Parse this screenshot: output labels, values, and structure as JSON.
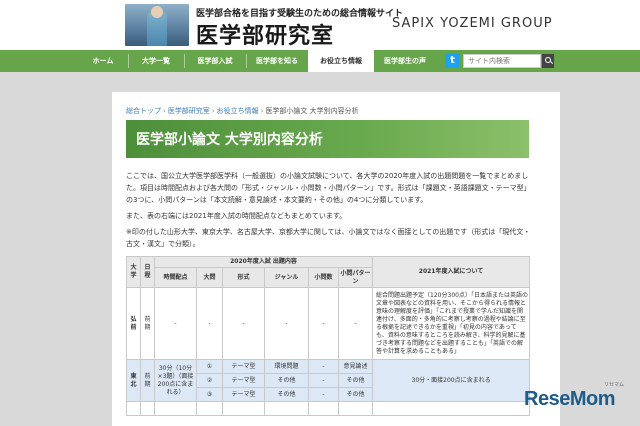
{
  "header": {
    "tagline": "医学部合格を目指す受験生のための総合情報サイト",
    "title": "医学部研究室",
    "group": "SAPIX YOZEMI GROUP"
  },
  "nav": {
    "items": [
      {
        "label": "ホーム"
      },
      {
        "label": "大学一覧"
      },
      {
        "label": "医学部入試"
      },
      {
        "label": "医学部を知る"
      },
      {
        "label": "お役立ち情報"
      },
      {
        "label": "医学部生の声"
      }
    ],
    "active_index": 4,
    "search_placeholder": "サイト内検索",
    "twitter_glyph": "t",
    "colors": {
      "nav_bg": "#67a54a",
      "twitter": "#1da1f2"
    }
  },
  "breadcrumb": {
    "items": [
      "総合トップ",
      "医学部研究室",
      "お役立ち情報",
      "医学部小論文 大学別内容分析"
    ],
    "separator": "›"
  },
  "page": {
    "title": "医学部小論文 大学別内容分析",
    "intro": "ここでは、国公立大学医学部医学科（一般選抜）の小論文試験について、各大学の2020年度入試の出題問題を一覧でまとめました。項目は時間配点および各大問の「形式・ジャンル・小問数・小問パターン」です。形式は「課題文・英語課題文・テーマ型」の3つに、小問パターンは「本文読解・意見論述・本文要約・その他」の4つに分類しています。",
    "note_2021": "また、表の右端には2021年度入試の時間配点などもまとめています。",
    "note_marked": "※印の付した山形大学、東京大学、名古屋大学、京都大学に関しては、小論文ではなく面接としての出題です（形式は「現代文・古文・漢文」で分類）。"
  },
  "table": {
    "headers": {
      "univ": "大学",
      "schedule": "日程",
      "group_2020": "2020年度入試 出題内容",
      "time_score": "時間配点",
      "daimon": "大問",
      "format": "形式",
      "genre": "ジャンル",
      "shomon_count": "小問数",
      "shomon_pattern": "小問パターン",
      "col_2021": "2021年度入試について"
    },
    "rows": [
      {
        "univ": "弘前",
        "schedule": "前期",
        "time_score": "-",
        "daimon": "-",
        "format": "-",
        "genre": "-",
        "shomon_count": "-",
        "shomon_pattern": "-",
        "note_2021": "総合問題出題予定（120分300点）「日本語または英語の文章や図表などの資料を用い、そこから得られる情報と意味の理解度を評価」「これまで授業で学んだ知識を関連付け、多面的・多角的に考察し考察の過程や結論に至る根拠を記述できるかを重視」「初見の内容であっても、資料の意味するところを読み解き、科学的見解に基づき考察する問題などを出題することも」「英語での解答や計算を求めることもある」"
      },
      {
        "univ": "東北",
        "schedule": "前期",
        "time_score": "30分（10分×3題）（面接200点に含まれる）",
        "sub": [
          {
            "daimon": "①",
            "format": "テーマ型",
            "genre": "環境問題",
            "shomon_count": "-",
            "shomon_pattern": "意見論述"
          },
          {
            "daimon": "②",
            "format": "テーマ型",
            "genre": "その他",
            "shomon_count": "-",
            "shomon_pattern": "その他"
          },
          {
            "daimon": "③",
            "format": "テーマ型",
            "genre": "その他",
            "shomon_count": "-",
            "shomon_pattern": "その他"
          }
        ],
        "note_2021": "30分・面接200点に含まれる"
      },
      {
        "univ": "",
        "schedule": "",
        "time_score": "",
        "daimon": "",
        "format": "",
        "genre": "",
        "shomon_count": "",
        "shomon_pattern": "",
        "note_2021": ""
      }
    ]
  },
  "watermark": {
    "logo": "ReseMom",
    "caption": "リセマム"
  }
}
